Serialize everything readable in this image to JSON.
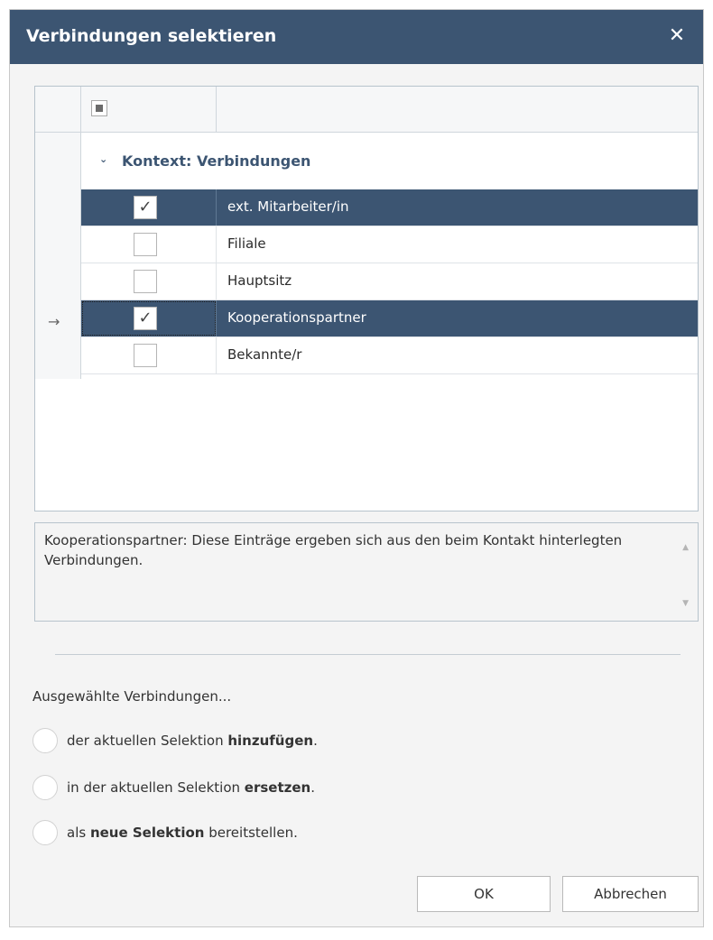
{
  "dialog": {
    "title": "Verbindungen selektieren",
    "close_glyph": "✕"
  },
  "grid": {
    "group_arrow": "⌄",
    "group_label": "Kontext: Verbindungen",
    "focused_row_arrow": "→",
    "rows": [
      {
        "label": "ext. Mitarbeiter/in",
        "checked": "✓"
      },
      {
        "label": "Filiale",
        "checked": ""
      },
      {
        "label": "Hauptsitz",
        "checked": ""
      },
      {
        "label": "Kooperationspartner",
        "checked": "✓"
      },
      {
        "label": "Bekannte/r",
        "checked": ""
      }
    ]
  },
  "description": {
    "text": "Kooperationspartner: Diese Einträge ergeben sich aus den beim Kontakt hinterlegten Verbindungen.",
    "scroll_up": "▲",
    "scroll_down": "▼"
  },
  "selection": {
    "label": "Ausgewählte Verbindungen...",
    "options": [
      {
        "pre": "der aktuellen Selektion ",
        "bold": "hinzufügen",
        "post": "."
      },
      {
        "pre": "in der aktuellen Selektion ",
        "bold": "ersetzen",
        "post": "."
      },
      {
        "pre": "als ",
        "bold": "neue Selektion",
        "post": " bereitstellen."
      }
    ]
  },
  "buttons": {
    "ok": "OK",
    "cancel": "Abbrechen"
  },
  "colors": {
    "titlebar": "#3c5572",
    "selected_row": "#3c5572"
  }
}
